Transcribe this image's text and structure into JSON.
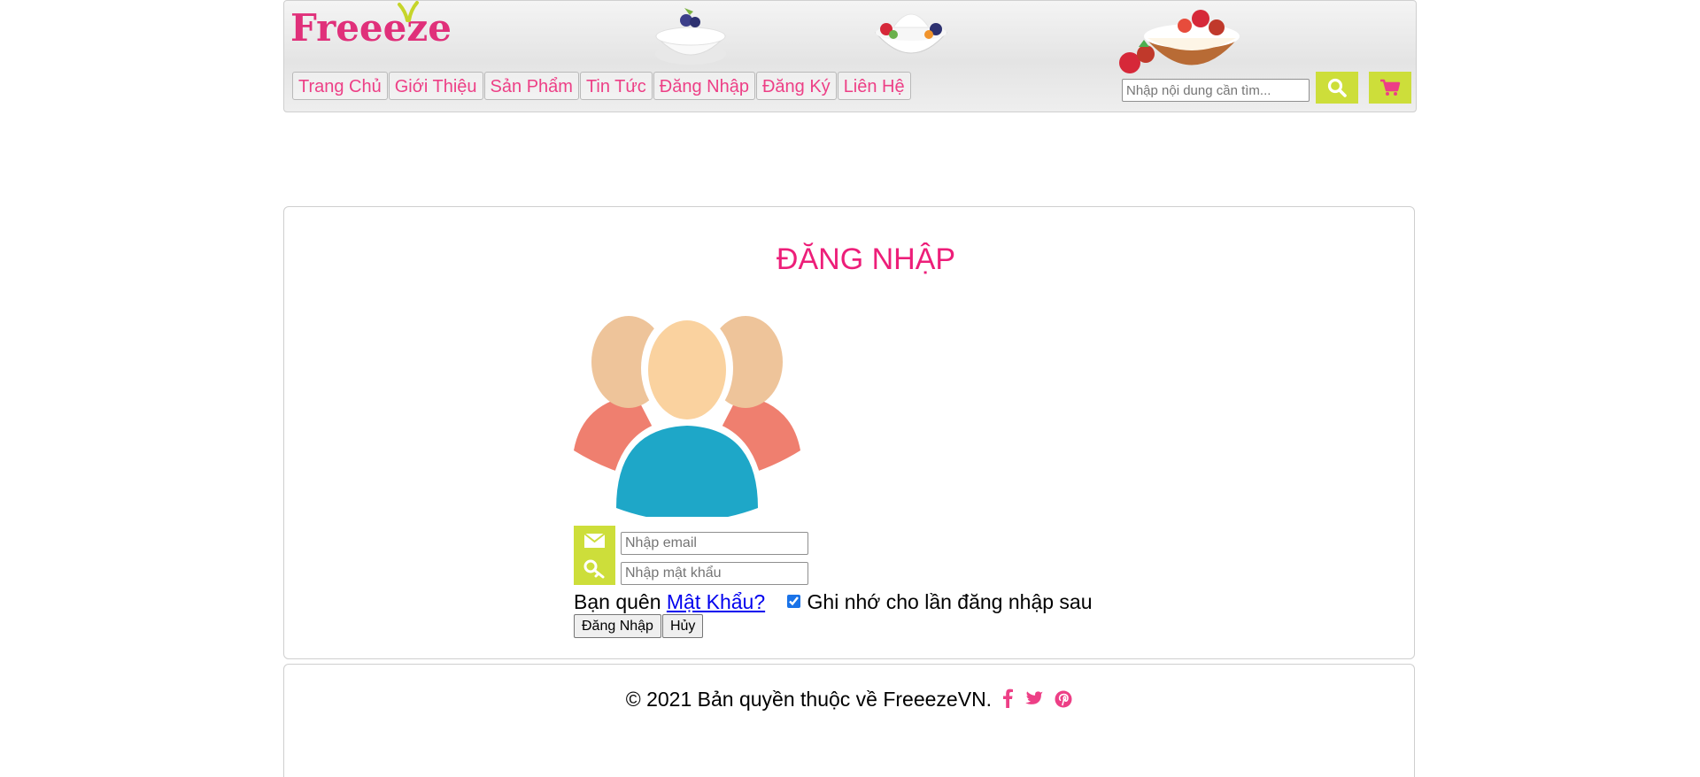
{
  "brand": {
    "logo_text": "Freeeze",
    "accent_pink": "#ed3f86",
    "accent_lime": "#cdde3a"
  },
  "nav": {
    "items": [
      {
        "label": "Trang Chủ"
      },
      {
        "label": "Giới Thiệu"
      },
      {
        "label": "Sản Phẩm"
      },
      {
        "label": "Tin Tức"
      },
      {
        "label": "Đăng Nhập"
      },
      {
        "label": "Đăng Ký"
      },
      {
        "label": "Liên Hệ"
      }
    ]
  },
  "search": {
    "placeholder": "Nhập nội dung cần tìm...",
    "button_icon": "search-icon"
  },
  "cart": {
    "icon": "shopping-cart-icon"
  },
  "login": {
    "title": "ĐĂNG NHẬP",
    "email_placeholder": "Nhập email",
    "password_placeholder": "Nhập mật khẩu",
    "forgot_prefix": "Bạn quên",
    "forgot_link": "Mật Khẩu?",
    "remember_checked": true,
    "remember_label": "Ghi nhớ cho lần đăng nhập sau",
    "submit_label": "Đăng Nhập",
    "cancel_label": "Hủy"
  },
  "footer": {
    "copyright": "© 2021 Bản quyền thuộc về FreeezeVN.",
    "social_icons": [
      "facebook-icon",
      "twitter-icon",
      "pinterest-icon"
    ]
  }
}
